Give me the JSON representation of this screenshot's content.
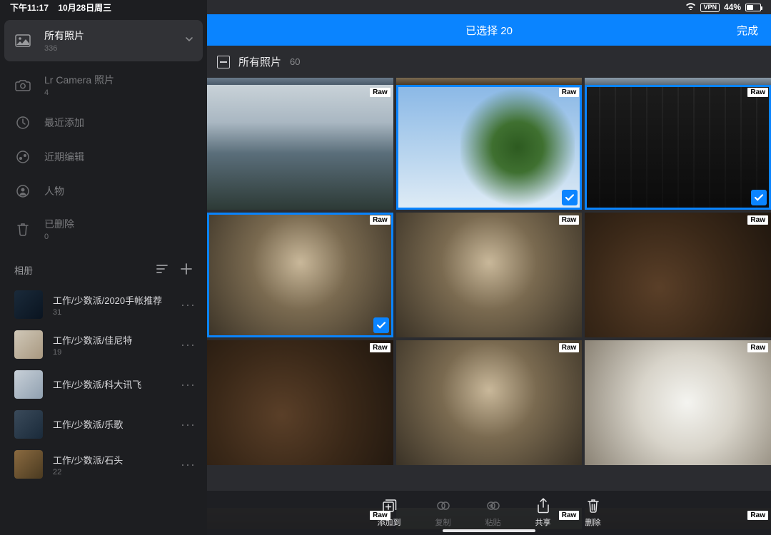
{
  "status": {
    "time": "下午11:17",
    "date": "10月28日周三",
    "vpn": "VPN",
    "battery_pct": "44%"
  },
  "sidebar": {
    "items": [
      {
        "title": "所有照片",
        "count": "336",
        "icon": "photo"
      },
      {
        "title": "Lr Camera 照片",
        "count": "4",
        "icon": "camera"
      },
      {
        "title": "最近添加",
        "count": "",
        "icon": "clock"
      },
      {
        "title": "近期编辑",
        "count": "",
        "icon": "edit"
      },
      {
        "title": "人物",
        "count": "",
        "icon": "person"
      },
      {
        "title": "已删除",
        "count": "0",
        "icon": "trash"
      }
    ],
    "albums_label": "相册",
    "albums": [
      {
        "title": "工作/少数派/2020手帐推荐",
        "count": "31"
      },
      {
        "title": "工作/少数派/佳尼特",
        "count": "19"
      },
      {
        "title": "工作/少数派/科大讯飞",
        "count": ""
      },
      {
        "title": "工作/少数派/乐歌",
        "count": ""
      },
      {
        "title": "工作/少数派/石头",
        "count": "22"
      }
    ]
  },
  "selection": {
    "label": "已选择 20",
    "done": "完成"
  },
  "grid_header": {
    "title": "所有照片",
    "count": "60"
  },
  "badges": {
    "raw": "Raw"
  },
  "toolbar": {
    "add": "添加到",
    "copy": "复制",
    "paste": "粘贴",
    "share": "共享",
    "delete": "删除"
  }
}
